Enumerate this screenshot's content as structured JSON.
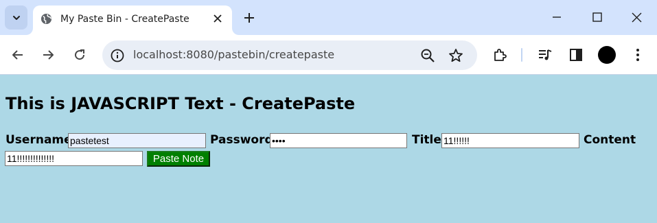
{
  "browser": {
    "tab_title": "My Paste Bin - CreatePaste",
    "url": "localhost:8080/pastebin/createpaste"
  },
  "page": {
    "heading": "This is JAVASCRIPT Text - CreatePaste",
    "username_label": "Username",
    "username_value": "pastetest",
    "password_label": "Password",
    "password_value": "••••",
    "title_label": "Title",
    "title_value": "11!!!!!!",
    "content_label": "Content",
    "content_value": "11!!!!!!!!!!!!!!",
    "submit_label": "Paste Note"
  },
  "colors": {
    "page_background": "#add8e6",
    "submit_background": "#008000",
    "tabstrip": "#d3e3fd"
  }
}
